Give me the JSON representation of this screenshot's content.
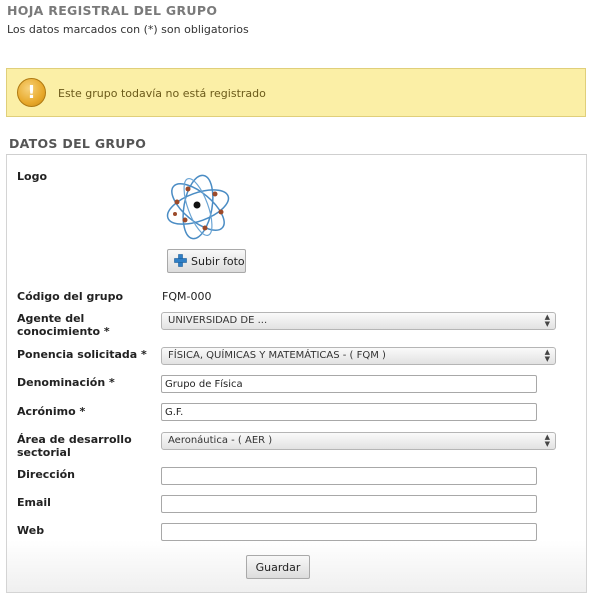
{
  "header": {
    "title": "HOJA REGISTRAL DEL GRUPO",
    "subtitle": "Los datos marcados con (*) son obligatorios"
  },
  "alert": {
    "icon": "exclamation-icon",
    "message": "Este grupo todavía no está registrado",
    "color": "#fbefa6"
  },
  "section": {
    "title": "DATOS DEL GRUPO"
  },
  "form": {
    "logo_label": "Logo",
    "upload_button": "Subir foto",
    "codigo": {
      "label": "Código del grupo",
      "value": "FQM-000"
    },
    "agente": {
      "label_line1": "Agente del",
      "label_line2": "conocimiento *",
      "selected": "UNIVERSIDAD DE ..."
    },
    "ponencia": {
      "label": "Ponencia solicitada *",
      "selected": "FÍSICA, QUÍMICAS Y MATEMÁTICAS - ( FQM )"
    },
    "denominacion": {
      "label": "Denominación *",
      "value": "Grupo de Física"
    },
    "acronimo": {
      "label": "Acrónimo *",
      "value": "G.F."
    },
    "area": {
      "label_line1": "Área de desarrollo",
      "label_line2": "sectorial",
      "selected": "Aeronáutica - ( AER )"
    },
    "direccion": {
      "label": "Dirección",
      "value": ""
    },
    "email": {
      "label": "Email",
      "value": ""
    },
    "web": {
      "label": "Web",
      "value": ""
    },
    "save_button": "Guardar"
  }
}
